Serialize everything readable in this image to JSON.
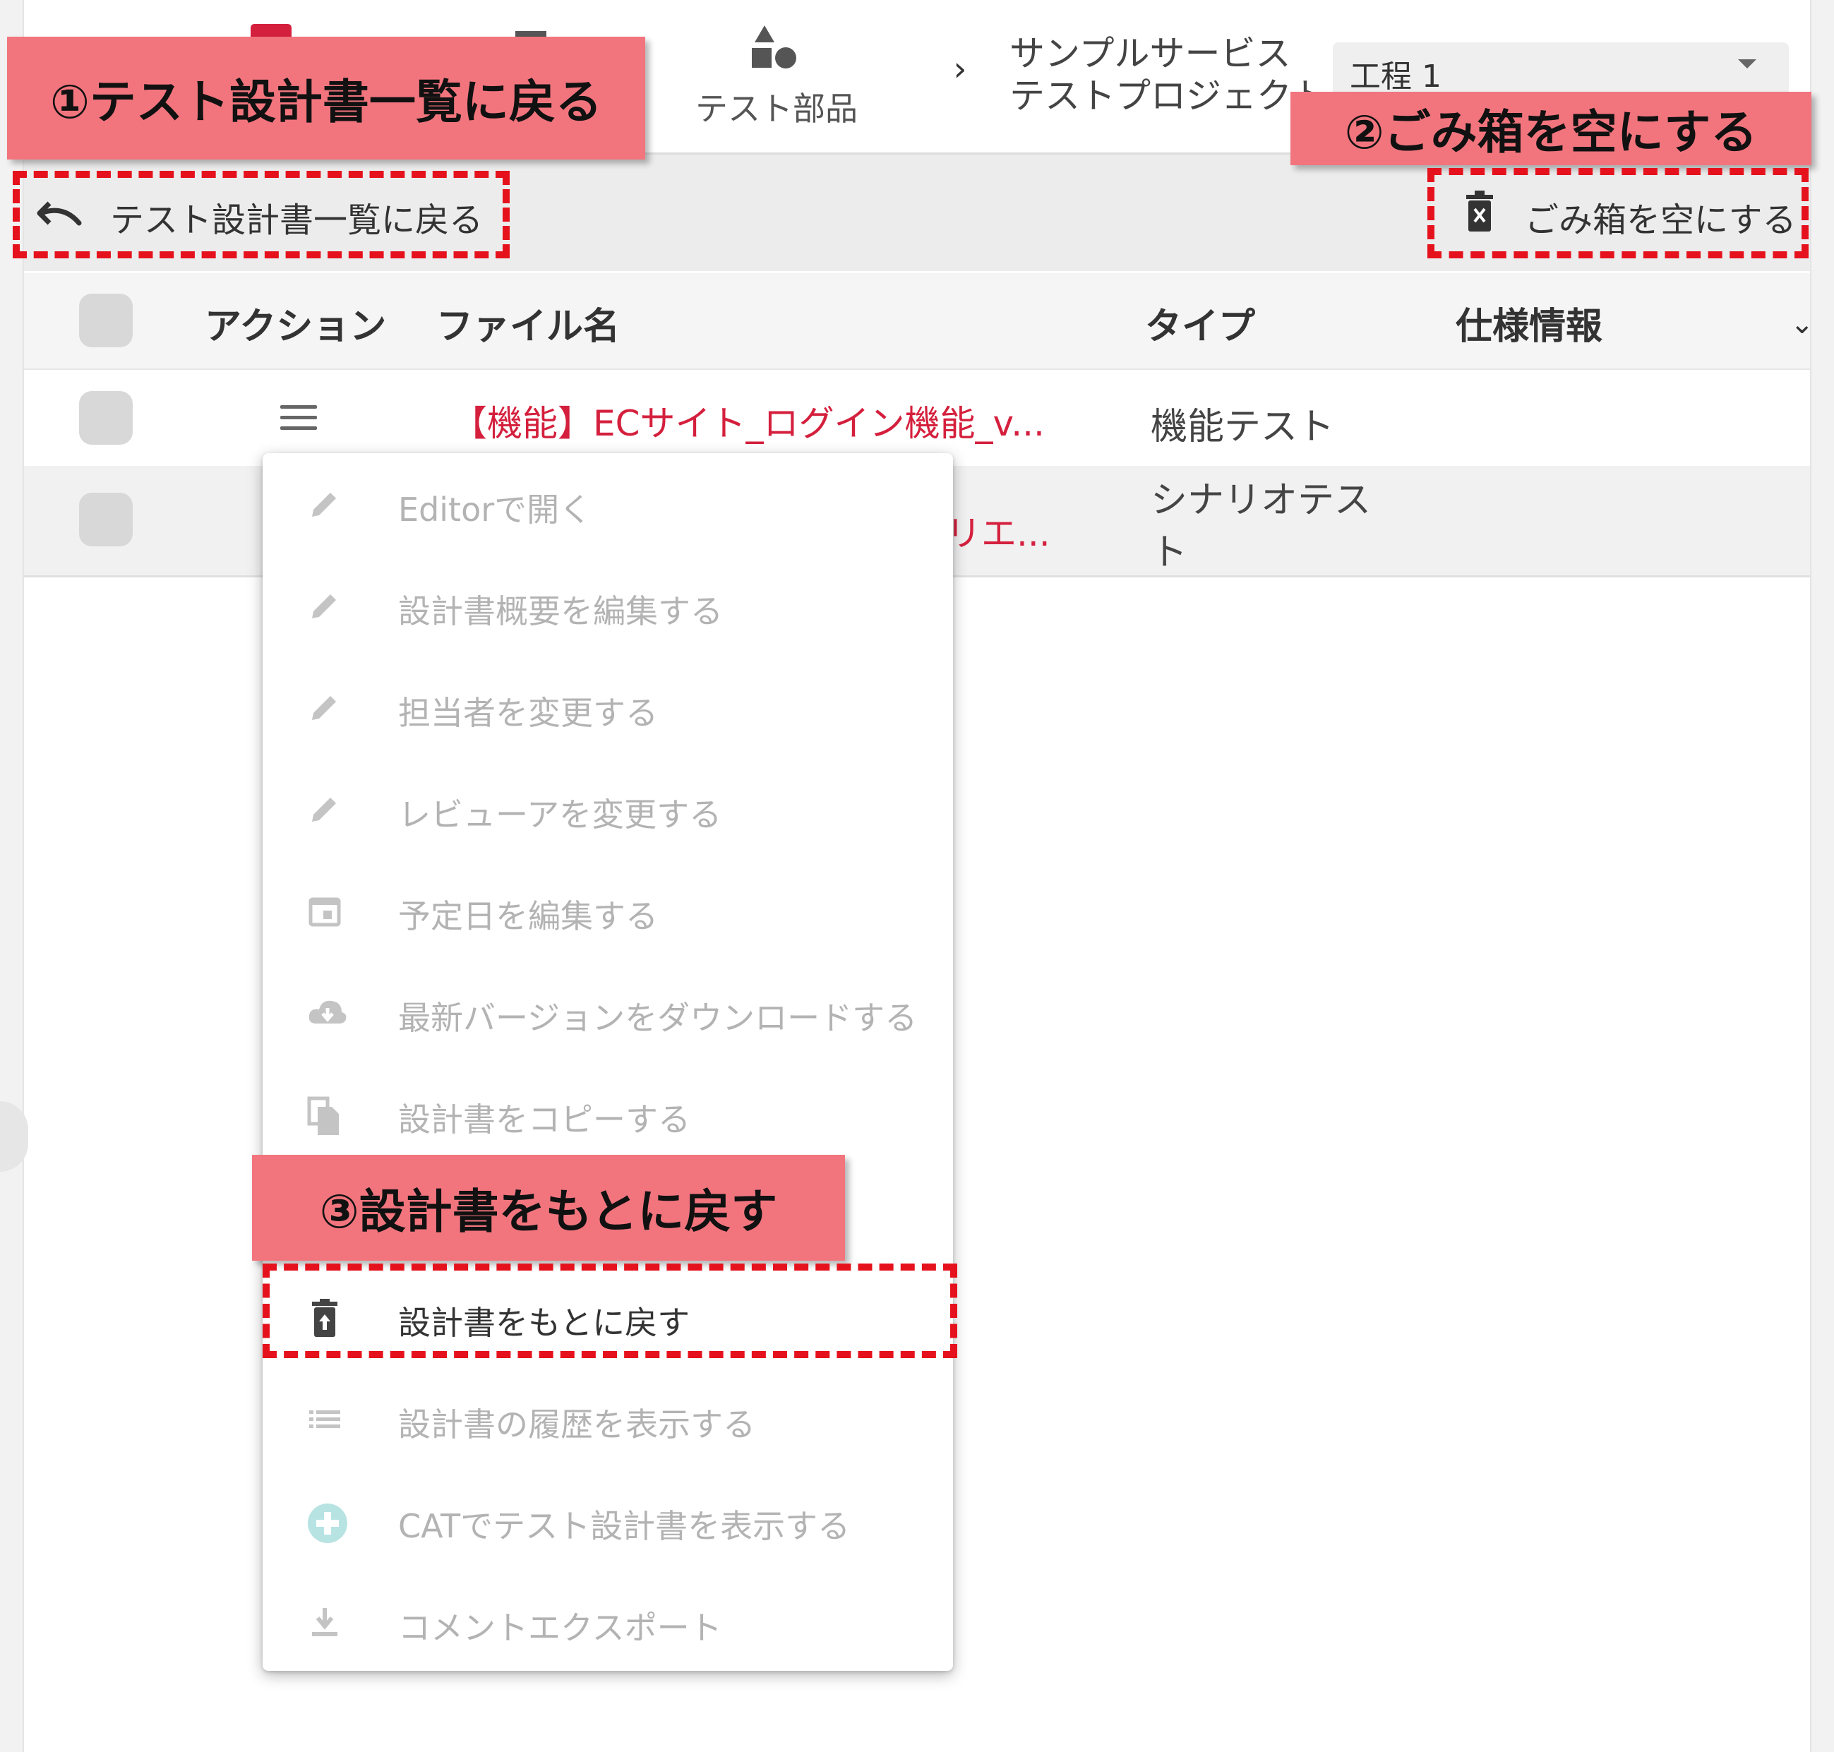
{
  "topbar": {
    "parts_label": "テスト部品",
    "breadcrumb_separator": "›",
    "breadcrumb_line1": "サンプルサービス",
    "breadcrumb_line2": "テストプロジェクト",
    "process_value": "工程 1"
  },
  "toolbar": {
    "back_label": "テスト設計書一覧に戻る",
    "empty_trash_label": "ごみ箱を空にする"
  },
  "table": {
    "headers": {
      "action": "アクション",
      "filename": "ファイル名",
      "type": "タイプ",
      "spec": "仕様情報",
      "more": "⌄"
    },
    "rows": [
      {
        "filename": "【機能】ECサイト_ログイン機能_v...",
        "type": "機能テスト"
      },
      {
        "filename_partial": "リエ...",
        "type_line1": "シナリオテス",
        "type_line2": "ト"
      }
    ]
  },
  "menu": {
    "items": [
      {
        "label": "Editorで開く",
        "icon": "pencil-icon",
        "enabled": false
      },
      {
        "label": "設計書概要を編集する",
        "icon": "pencil-icon",
        "enabled": false
      },
      {
        "label": "担当者を変更する",
        "icon": "pencil-icon",
        "enabled": false
      },
      {
        "label": "レビューアを変更する",
        "icon": "pencil-icon",
        "enabled": false
      },
      {
        "label": "予定日を編集する",
        "icon": "calendar-icon",
        "enabled": false
      },
      {
        "label": "最新バージョンをダウンロードする",
        "icon": "cloud-download-icon",
        "enabled": false
      },
      {
        "label": "設計書をコピーする",
        "icon": "copy-icon",
        "enabled": false
      },
      {
        "label": "",
        "icon": "",
        "enabled": false
      },
      {
        "label": "設計書をもとに戻す",
        "icon": "restore-from-trash-icon",
        "enabled": true
      },
      {
        "label": "設計書の履歴を表示する",
        "icon": "list-icon",
        "enabled": false
      },
      {
        "label": "CATでテスト設計書を表示する",
        "icon": "plus-circle-icon",
        "enabled": false
      },
      {
        "label": "コメントエクスポート",
        "icon": "download-icon",
        "enabled": false
      }
    ]
  },
  "annotations": {
    "callout1": "①テスト設計書一覧に戻る",
    "callout2": "②ごみ箱を空にする",
    "callout3": "③設計書をもとに戻す"
  },
  "colors": {
    "accent_red": "#d4203d",
    "callout_pink": "#f2757e",
    "dash_red": "#e5121d"
  }
}
